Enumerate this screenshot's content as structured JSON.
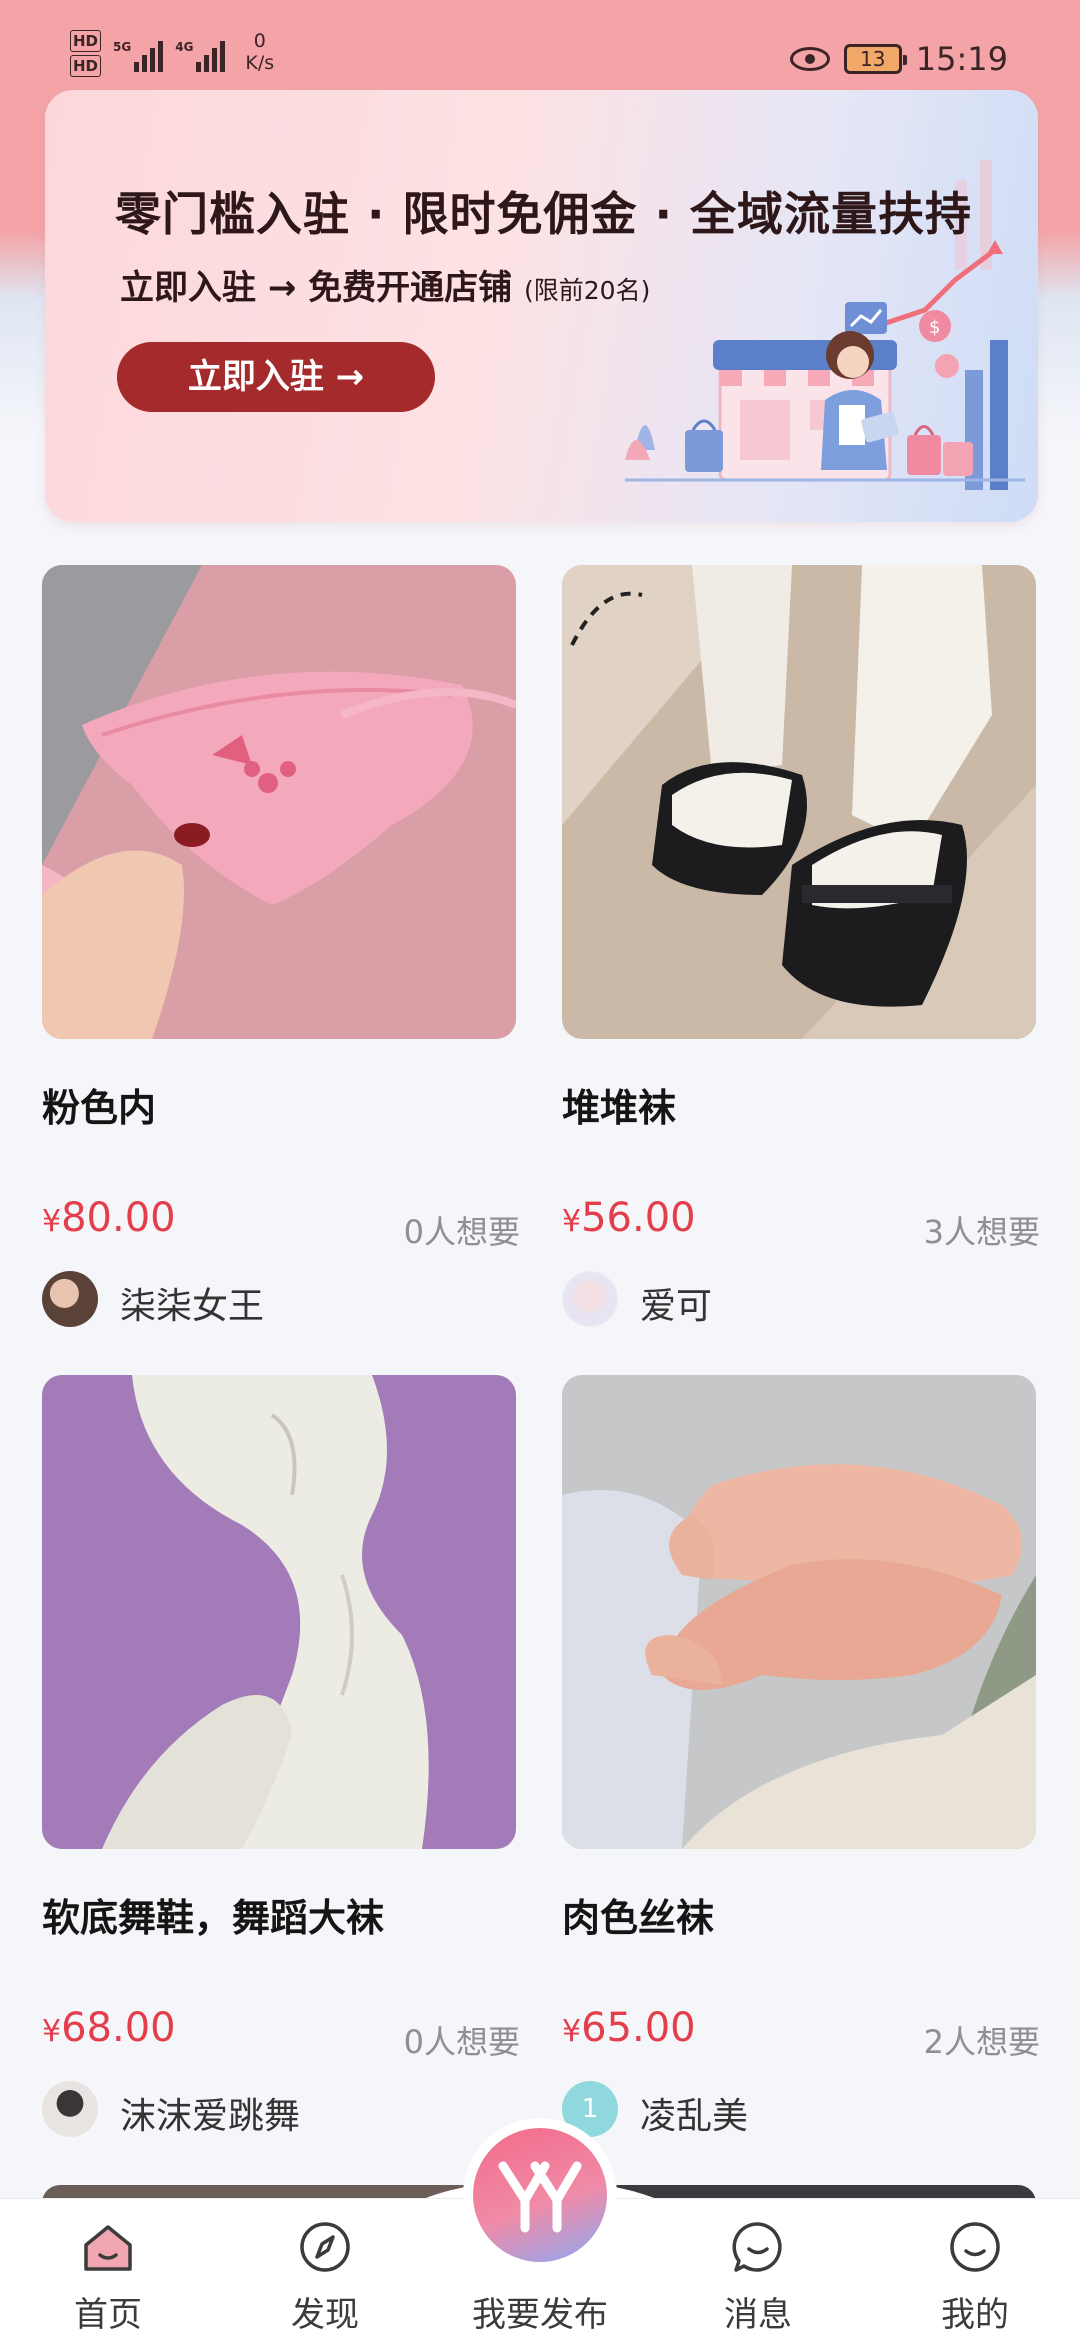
{
  "status_bar": {
    "hd1": "HD",
    "hd2": "HD",
    "net1": "5G",
    "net2": "4G",
    "speed_value": "0",
    "speed_unit": "K/s",
    "battery": "13",
    "time": "15:19"
  },
  "banner": {
    "title": "零门槛入驻 · 限时免佣金 · 全域流量扶持",
    "subtitle": "立即入驻 → 免费开通店铺",
    "subtitle_note": "(限前20名)",
    "button_label": "立即入驻 →"
  },
  "products": [
    {
      "title": "粉色内",
      "currency": "¥",
      "price": "80.00",
      "wants": "0人想要",
      "seller": "柒柒女王"
    },
    {
      "title": "堆堆袜",
      "currency": "¥",
      "price": "56.00",
      "wants": "3人想要",
      "seller": "爱可"
    },
    {
      "title": "软底舞鞋，舞蹈大袜",
      "currency": "¥",
      "price": "68.00",
      "wants": "0人想要",
      "seller": "沫沫爱跳舞"
    },
    {
      "title": "肉色丝袜",
      "currency": "¥",
      "price": "65.00",
      "wants": "2人想要",
      "seller": "凌乱美",
      "avatar_text": "1"
    }
  ],
  "bottom_nav": {
    "home": "首页",
    "discover": "发现",
    "publish": "我要发布",
    "messages": "消息",
    "mine": "我的"
  },
  "colors": {
    "accent": "#e43d4b",
    "header_pink": "#f4a3a6",
    "banner_button": "#a42a2c"
  }
}
